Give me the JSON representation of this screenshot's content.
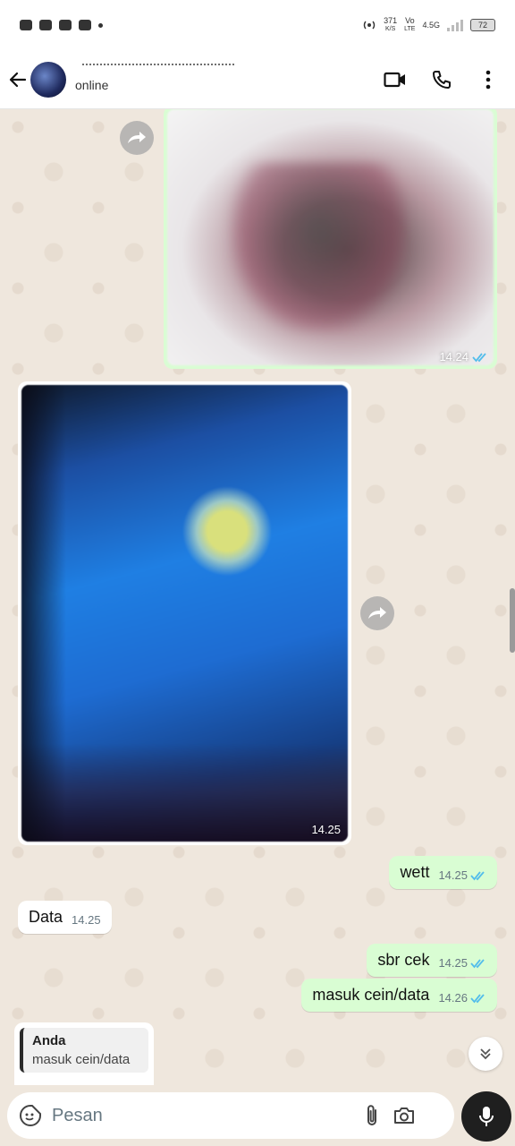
{
  "status_bar": {
    "speed_value": "371",
    "speed_unit": "K/S",
    "network_top": "Vo",
    "network_bottom": "LTE",
    "signal_label": "4.5G",
    "battery": "72"
  },
  "header": {
    "status": "online"
  },
  "messages": {
    "img_out_time": "14.24",
    "img_in_time": "14.25",
    "m1": {
      "text": "wett",
      "time": "14.25"
    },
    "m2": {
      "text": "Data",
      "time": "14.25"
    },
    "m3": {
      "text": "sbr cek",
      "time": "14.25"
    },
    "m4": {
      "text": "masuk cein/data",
      "time": "14.26"
    }
  },
  "reply": {
    "author": "Anda",
    "quoted": "masuk cein/data"
  },
  "composer": {
    "placeholder": "Pesan"
  },
  "colors": {
    "outgoing_bubble": "#d9fdd3",
    "incoming_bubble": "#ffffff",
    "read_tick": "#53bdeb",
    "wallpaper": "#efe7dd"
  }
}
